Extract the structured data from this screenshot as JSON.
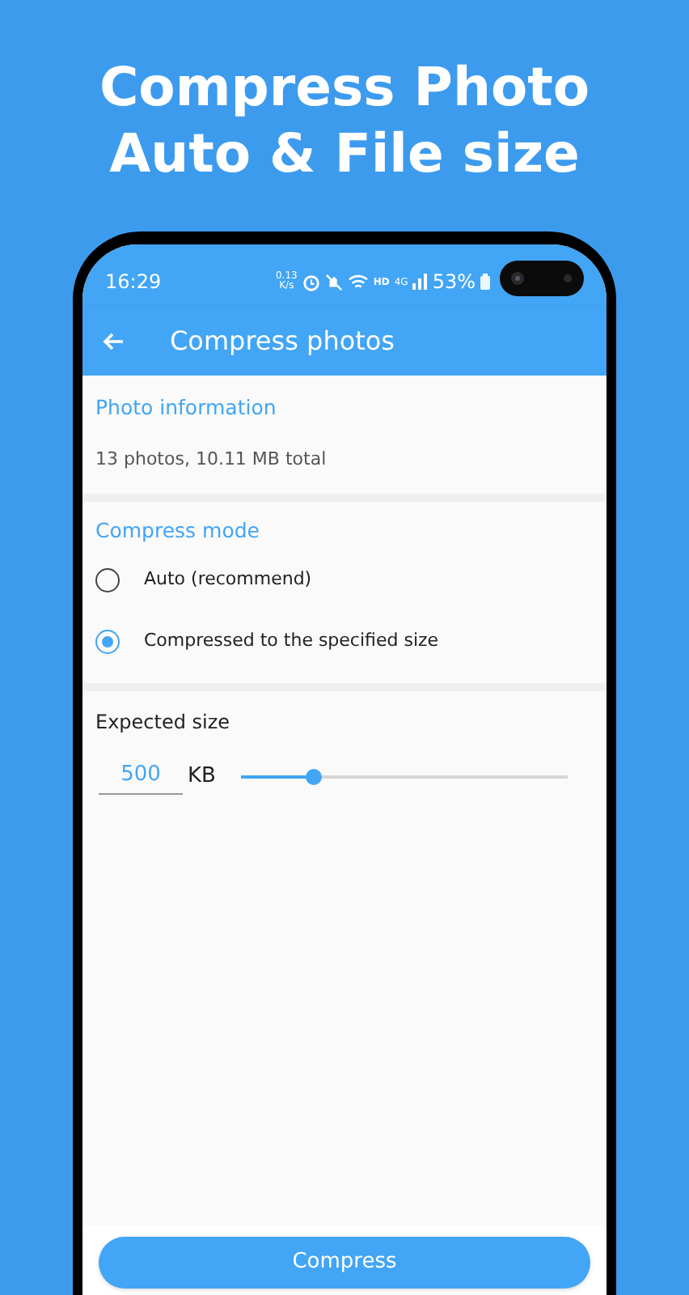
{
  "headline": [
    "Compress Photo",
    "Auto & File size"
  ],
  "status_bar": {
    "time": "16:29",
    "net_speed": [
      "0.13",
      "K/s"
    ],
    "hd": "HD",
    "network": "4G",
    "battery": "53%"
  },
  "toolbar": {
    "title": "Compress photos"
  },
  "photo_info": {
    "heading": "Photo information",
    "summary": "13 photos, 10.11 MB total"
  },
  "compress_mode": {
    "heading": "Compress mode",
    "options": [
      {
        "label": "Auto (recommend)",
        "selected": false
      },
      {
        "label": "Compressed to the specified size",
        "selected": true
      }
    ]
  },
  "expected_size": {
    "heading": "Expected size",
    "value": "500",
    "unit": "KB",
    "level": 0.22
  },
  "compress_button": "Compress"
}
